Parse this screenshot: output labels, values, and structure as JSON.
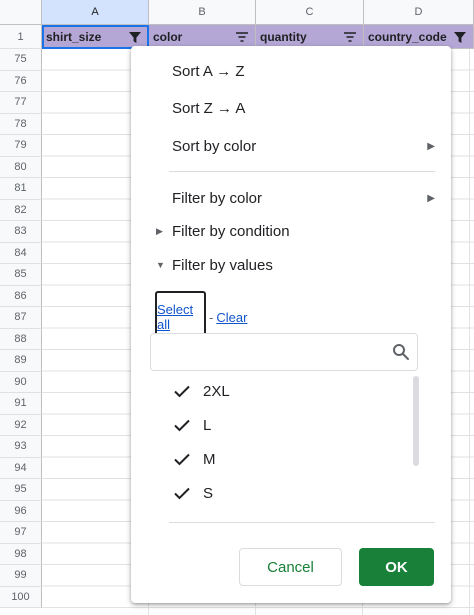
{
  "sheet": {
    "columns": [
      "A",
      "B",
      "C",
      "D"
    ],
    "headers": [
      "shirt_size",
      "color",
      "quantity",
      "country_code"
    ],
    "rows": [
      "1",
      "75",
      "76",
      "77",
      "78",
      "79",
      "80",
      "81",
      "82",
      "83",
      "84",
      "85",
      "86",
      "87",
      "88",
      "89",
      "90",
      "91",
      "92",
      "93",
      "94",
      "95",
      "96",
      "97",
      "98",
      "99",
      "100"
    ],
    "header_color": "#b4a7d6",
    "accent_color": "#1a73e8"
  },
  "menu": {
    "sort_az": "Sort A → Z",
    "sort_za": "Sort Z → A",
    "sort_by_color": "Sort by color",
    "filter_by_color": "Filter by color",
    "filter_by_condition": "Filter by condition",
    "filter_by_values": "Filter by values",
    "select_all": "Select all",
    "link_separator": "-",
    "clear": "Clear",
    "search_placeholder": "",
    "values": [
      {
        "label": "2XL",
        "checked": true
      },
      {
        "label": "L",
        "checked": true
      },
      {
        "label": "M",
        "checked": true
      },
      {
        "label": "S",
        "checked": true
      }
    ],
    "cancel_label": "Cancel",
    "ok_label": "OK",
    "ok_color": "#188038"
  }
}
